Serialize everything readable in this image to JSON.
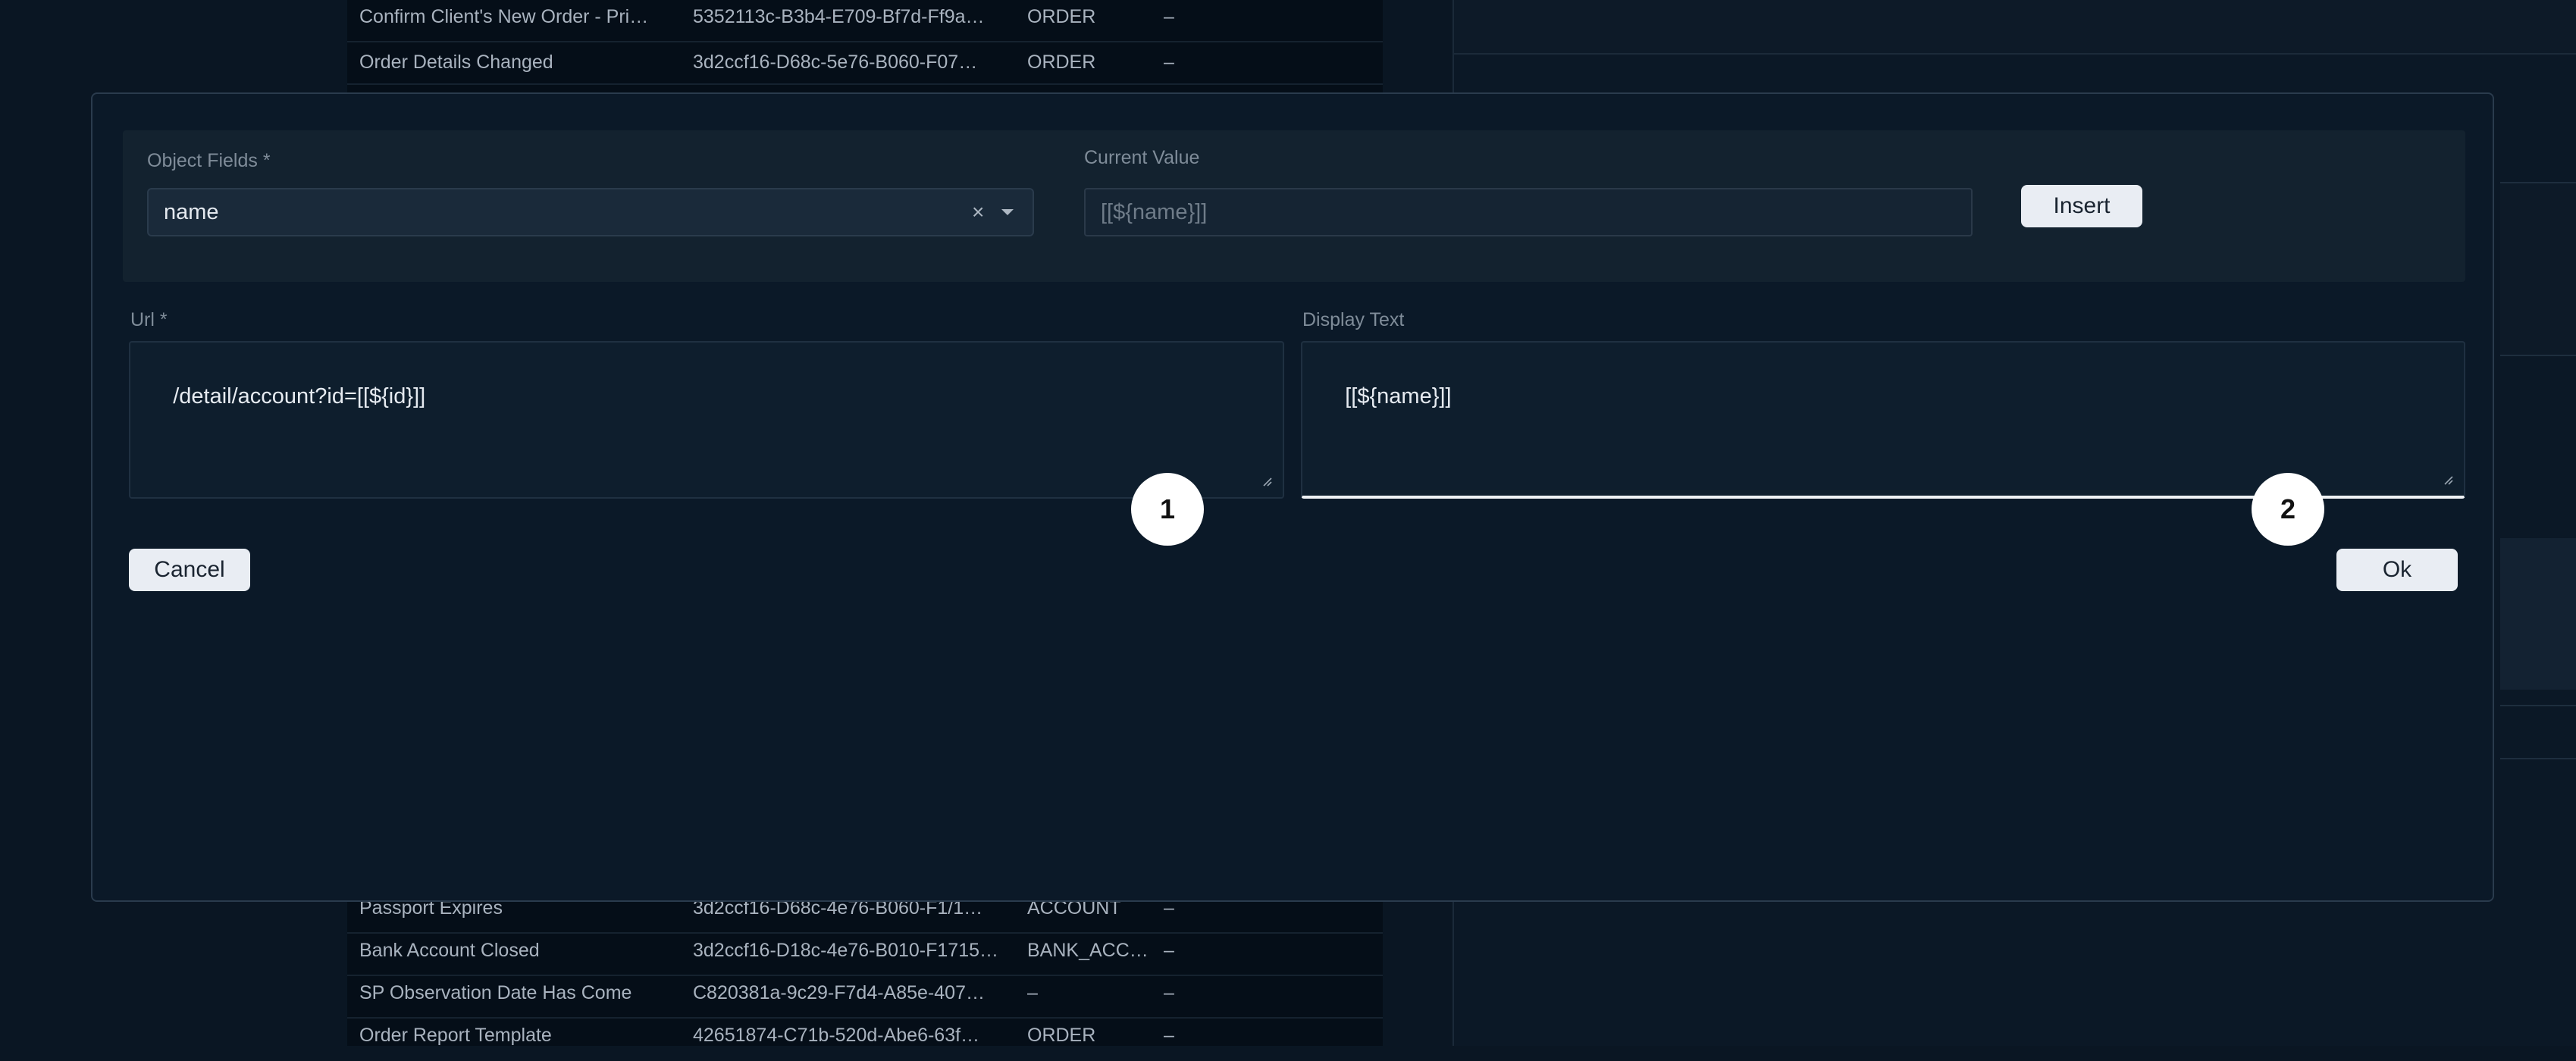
{
  "background_table": {
    "rows_top": [
      {
        "name": "Confirm Client's New Order - Pri…",
        "id": "5352113c-B3b4-E709-Bf7d-Ff9a…",
        "type": "ORDER",
        "extra": "–"
      },
      {
        "name": "Order Details Changed",
        "id": "3d2ccf16-D68c-5e76-B060-F07…",
        "type": "ORDER",
        "extra": "–"
      }
    ],
    "rows_bottom": [
      {
        "name": "Passport Expires",
        "id": "3d2ccf16-D68c-4e76-B060-F1/1…",
        "type": "ACCOUNT",
        "extra": "–"
      },
      {
        "name": "Bank Account Closed",
        "id": "3d2ccf16-D18c-4e76-B010-F1715…",
        "type": "BANK_ACC…",
        "extra": "–"
      },
      {
        "name": "SP Observation Date Has Come",
        "id": "C820381a-9c29-F7d4-A85e-407…",
        "type": "–",
        "extra": "–"
      },
      {
        "name": "Order Report Template",
        "id": "42651874-C71b-520d-Abe6-63f…",
        "type": "ORDER",
        "extra": "–"
      }
    ]
  },
  "modal": {
    "object_fields": {
      "label": "Object Fields *",
      "value": "name",
      "clear": "×"
    },
    "current_value": {
      "label": "Current Value",
      "value": "[[${name}]]"
    },
    "insert_label": "Insert",
    "url": {
      "label": "Url *",
      "value": "/detail/account?id=[[${id}]]"
    },
    "display_text": {
      "label": "Display Text",
      "value": "[[${name}]]"
    },
    "markers": [
      "1",
      "2"
    ],
    "cancel_label": "Cancel",
    "ok_label": "Ok"
  },
  "colors": {
    "background": "#0a1623",
    "modal": "#0b1928",
    "button": "#e9edf3",
    "focus_underline": "#eef1f4"
  }
}
